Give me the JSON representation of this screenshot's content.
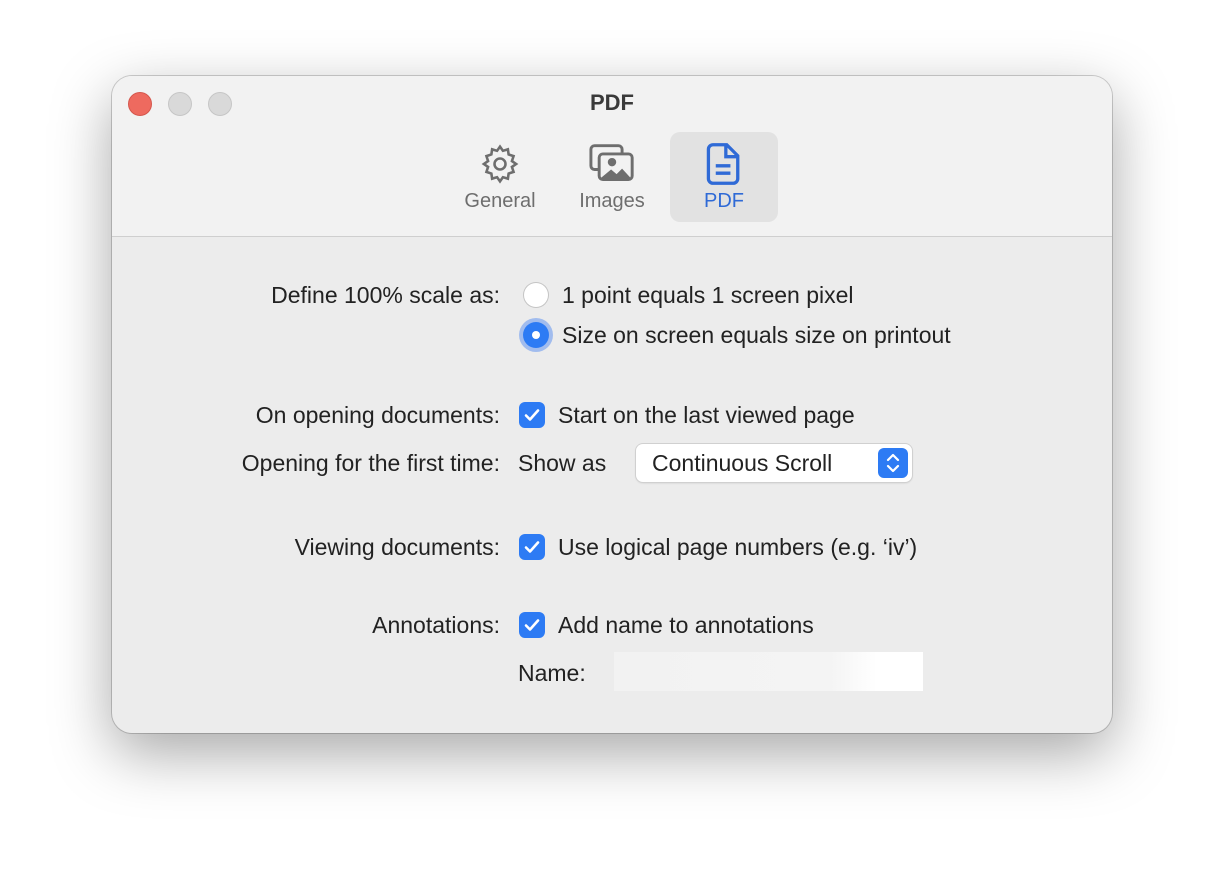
{
  "window": {
    "title": "PDF"
  },
  "toolbar": {
    "tabs": [
      {
        "label": "General",
        "icon": "gear-icon"
      },
      {
        "label": "Images",
        "icon": "images-icon"
      },
      {
        "label": "PDF",
        "icon": "document-icon",
        "selected": true
      }
    ]
  },
  "settings": {
    "scale": {
      "label": "Define 100% scale as:",
      "options": [
        "1 point equals 1 screen pixel",
        "Size on screen equals size on printout"
      ],
      "selected": 1
    },
    "opening": {
      "label": "On opening documents:",
      "checkbox": "Start on the last viewed page",
      "checked": true
    },
    "first_time": {
      "label": "Opening for the first time:",
      "prefix": "Show as",
      "select_value": "Continuous Scroll"
    },
    "viewing": {
      "label": "Viewing documents:",
      "checkbox": "Use logical page numbers (e.g. ‘iv’)",
      "checked": true
    },
    "annotations": {
      "label": "Annotations:",
      "checkbox": "Add name to annotations",
      "checked": true,
      "name_label": "Name:",
      "name_value": ""
    }
  },
  "colors": {
    "accent": "#2d7bf4",
    "close": "#ee6a5f"
  }
}
